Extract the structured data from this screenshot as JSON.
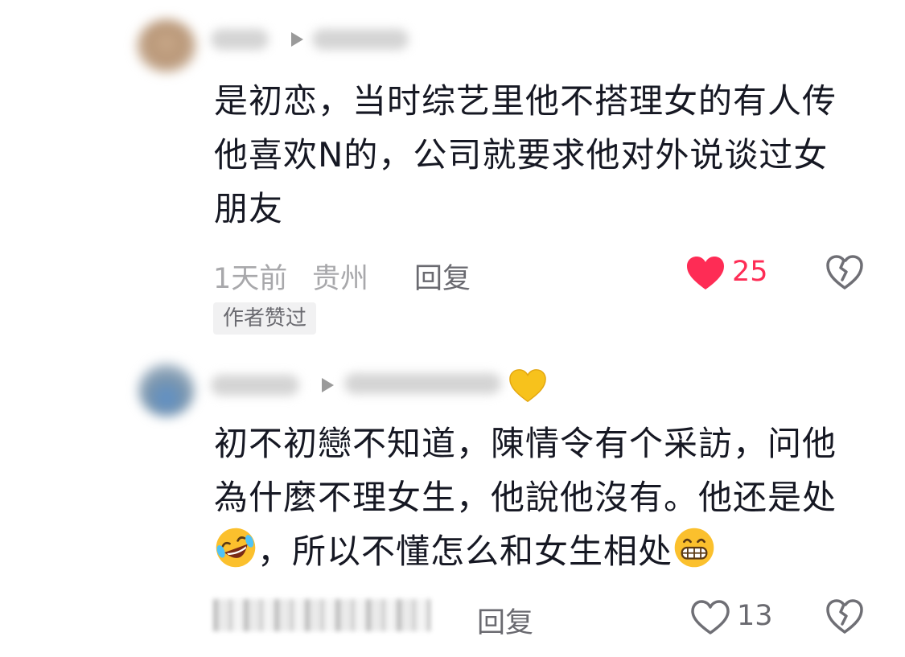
{
  "comments": [
    {
      "lines": [
        "是初恋，当时综艺里他不搭理女的有人传",
        "他喜欢N的，公司就要求他对外说谈过女",
        "朋友"
      ],
      "time": "1天前",
      "location": "贵州",
      "reply_label": "回复",
      "like_count": "25",
      "liked": true,
      "badge": "作者赞过"
    },
    {
      "line1": "初不初戀不知道，陳情令有个采訪，问他",
      "line2": "為什麼不理女生，他說他沒有。他还是处",
      "line3": "，所以不懂怎么和女生相处",
      "reply_label": "回复",
      "like_count": "13",
      "liked": false
    }
  ],
  "icons": {
    "like_filled": "heart-filled-icon",
    "like_outline": "heart-outline-icon",
    "dislike": "broken-heart-icon",
    "reply_indicator": "play-triangle-icon",
    "username_emoji": "yellow-heart-emoji",
    "crying_laugh": "rolling-laughing-emoji",
    "grin": "grinning-teeth-emoji"
  },
  "colors": {
    "like_red": "#fe2c55",
    "meta_gray": "#a8a8ab",
    "text": "#161823"
  }
}
